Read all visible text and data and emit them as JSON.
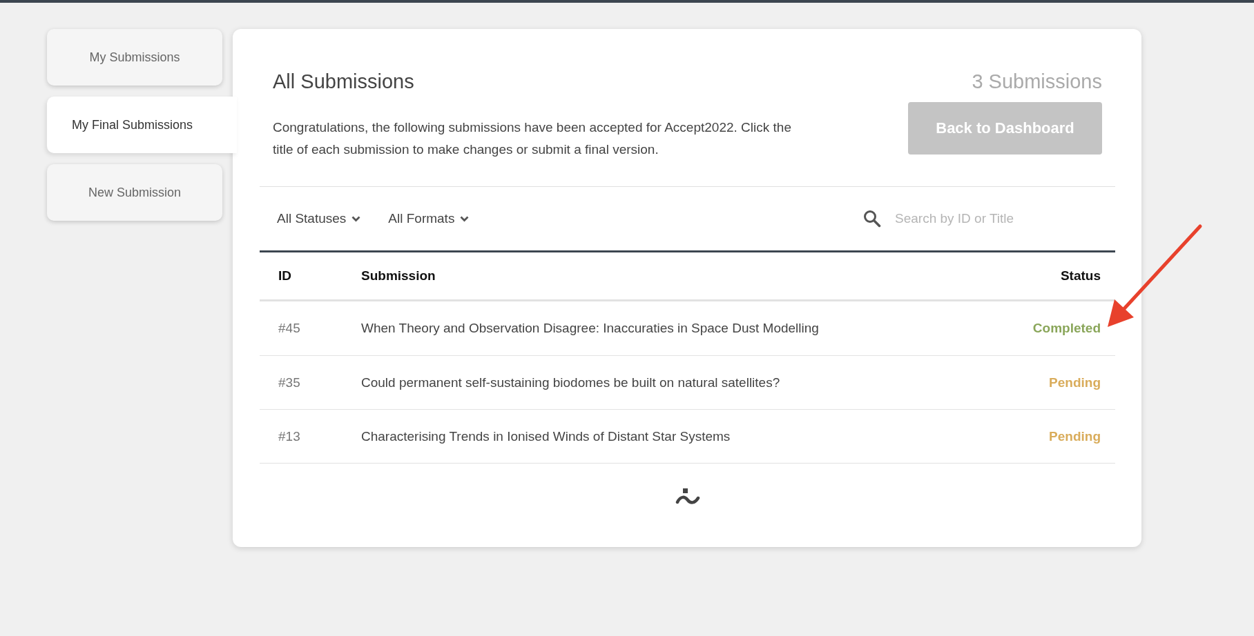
{
  "sidebar": {
    "items": [
      {
        "label": "My Submissions",
        "selected": false
      },
      {
        "label": "My Final Submissions",
        "selected": true
      },
      {
        "label": "New Submission",
        "selected": false
      }
    ]
  },
  "panel": {
    "title": "All Submissions",
    "count": "3 Submissions",
    "description": "Congratulations, the following submissions have been accepted for Accept2022. Click the title of each submission to make changes or submit a final version.",
    "button": {
      "label": "Back to Dashboard",
      "disabled": true
    }
  },
  "filters": [
    {
      "label": "All Statuses"
    },
    {
      "label": "All Formats"
    }
  ],
  "search": {
    "placeholder": "Search by ID or Title"
  },
  "table": {
    "columns": [
      "ID",
      "Submission",
      "Status"
    ],
    "rows": [
      {
        "id": "#45",
        "title": "When Theory and Observation Disagree: Inaccuraties in Space Dust Modelling",
        "status": "Completed",
        "color": "#8aa65a"
      },
      {
        "id": "#35",
        "title": "Could permanent self-sustaining biodomes be built on natural satellites?",
        "status": "Pending",
        "color": "#d9ac5b"
      },
      {
        "id": "#13",
        "title": "Characterising Trends in Ionised Winds of Distant Star Systems",
        "status": "Pending",
        "color": "#d9ac5b"
      }
    ]
  }
}
